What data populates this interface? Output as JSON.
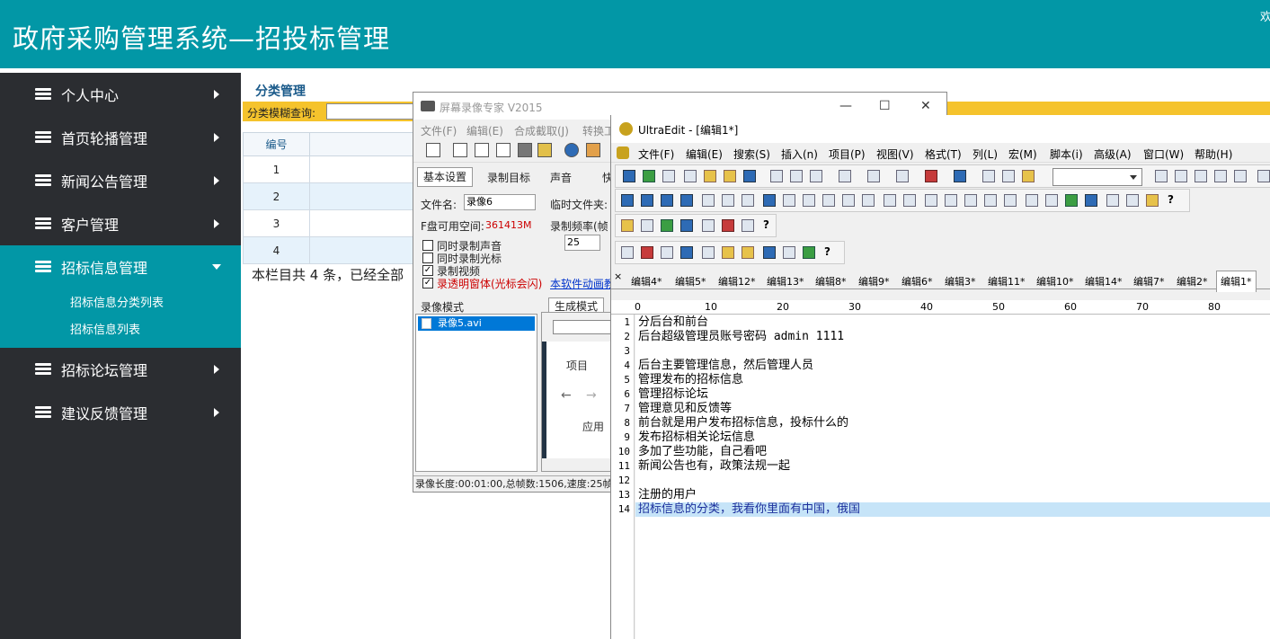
{
  "header": {
    "title": "政府采购管理系统—招投标管理",
    "welcome": "欢"
  },
  "sidebar": {
    "items": [
      {
        "label": "个人中心"
      },
      {
        "label": "首页轮播管理"
      },
      {
        "label": "新闻公告管理"
      },
      {
        "label": "客户管理"
      },
      {
        "label": "招标信息管理"
      },
      {
        "label": "招标论坛管理"
      },
      {
        "label": "建议反馈管理"
      }
    ],
    "submenu": [
      "招标信息分类列表",
      "招标信息列表"
    ]
  },
  "main": {
    "breadcrumb": "分类管理",
    "filter_label": "分类模糊查询:",
    "table": {
      "headers": [
        "编号",
        ""
      ],
      "rows": [
        [
          "1",
          ""
        ],
        [
          "2",
          ""
        ],
        [
          "3",
          ""
        ],
        [
          "4",
          ""
        ]
      ]
    },
    "page_info": "本栏目共 4 条，已经全部"
  },
  "recorder": {
    "title": "屏幕录像专家 V2015",
    "menu": [
      "文件(F)",
      "编辑(E)",
      "合成截取(J)",
      "转换工"
    ],
    "tabs": [
      "基本设置",
      "录制目标",
      "声音",
      "快"
    ],
    "filename_label": "文件名:",
    "filename_value": "录像6",
    "tempdir_label": "临时文件夹:",
    "disk_label": "F盘可用空间:",
    "disk_value": "361413M",
    "fps_label": "录制频率(帧",
    "fps_value": "25",
    "checkboxes": [
      {
        "label": "同时录制声音",
        "checked": false
      },
      {
        "label": "同时录制光标",
        "checked": false
      },
      {
        "label": "录制视频",
        "checked": true
      },
      {
        "label": "录透明窗体(光标会闪)",
        "checked": true
      }
    ],
    "link": "本软件动画教",
    "mode_label": "录像模式",
    "gen_label": "生成模式",
    "list_item": "录像5.avi",
    "preview_texts": [
      "项目",
      "应用"
    ],
    "status": "录像长度:00:01:00,总帧数:1506,速度:25帧"
  },
  "ultraedit": {
    "title": "UltraEdit - [编辑1*]",
    "menu": [
      "文件(F)",
      "编辑(E)",
      "搜索(S)",
      "插入(n)",
      "项目(P)",
      "视图(V)",
      "格式(T)",
      "列(L)",
      "宏(M)",
      "脚本(i)",
      "高级(A)",
      "窗口(W)",
      "帮助(H)"
    ],
    "file_tabs": [
      "编辑4*",
      "编辑5*",
      "编辑12*",
      "编辑13*",
      "编辑8*",
      "编辑9*",
      "编辑6*",
      "编辑3*",
      "编辑11*",
      "编辑10*",
      "编辑14*",
      "编辑7*",
      "编辑2*",
      "编辑1*"
    ],
    "ruler": [
      "0",
      "10",
      "20",
      "30",
      "40",
      "50",
      "60",
      "70",
      "80"
    ],
    "lines": [
      "分后台和前台",
      "后台超级管理员账号密码 admin 1111",
      "",
      "后台主要管理信息，然后管理人员",
      "管理发布的招标信息",
      "管理招标论坛",
      "管理意见和反馈等",
      "前台就是用户发布招标信息，投标什么的",
      "发布招标相关论坛信息",
      "多加了些功能，自己看吧",
      "新闻公告也有，政策法规一起",
      "",
      "注册的用户",
      "招标信息的分类，我看你里面有中国，俄国"
    ],
    "highlight_line": 14
  }
}
